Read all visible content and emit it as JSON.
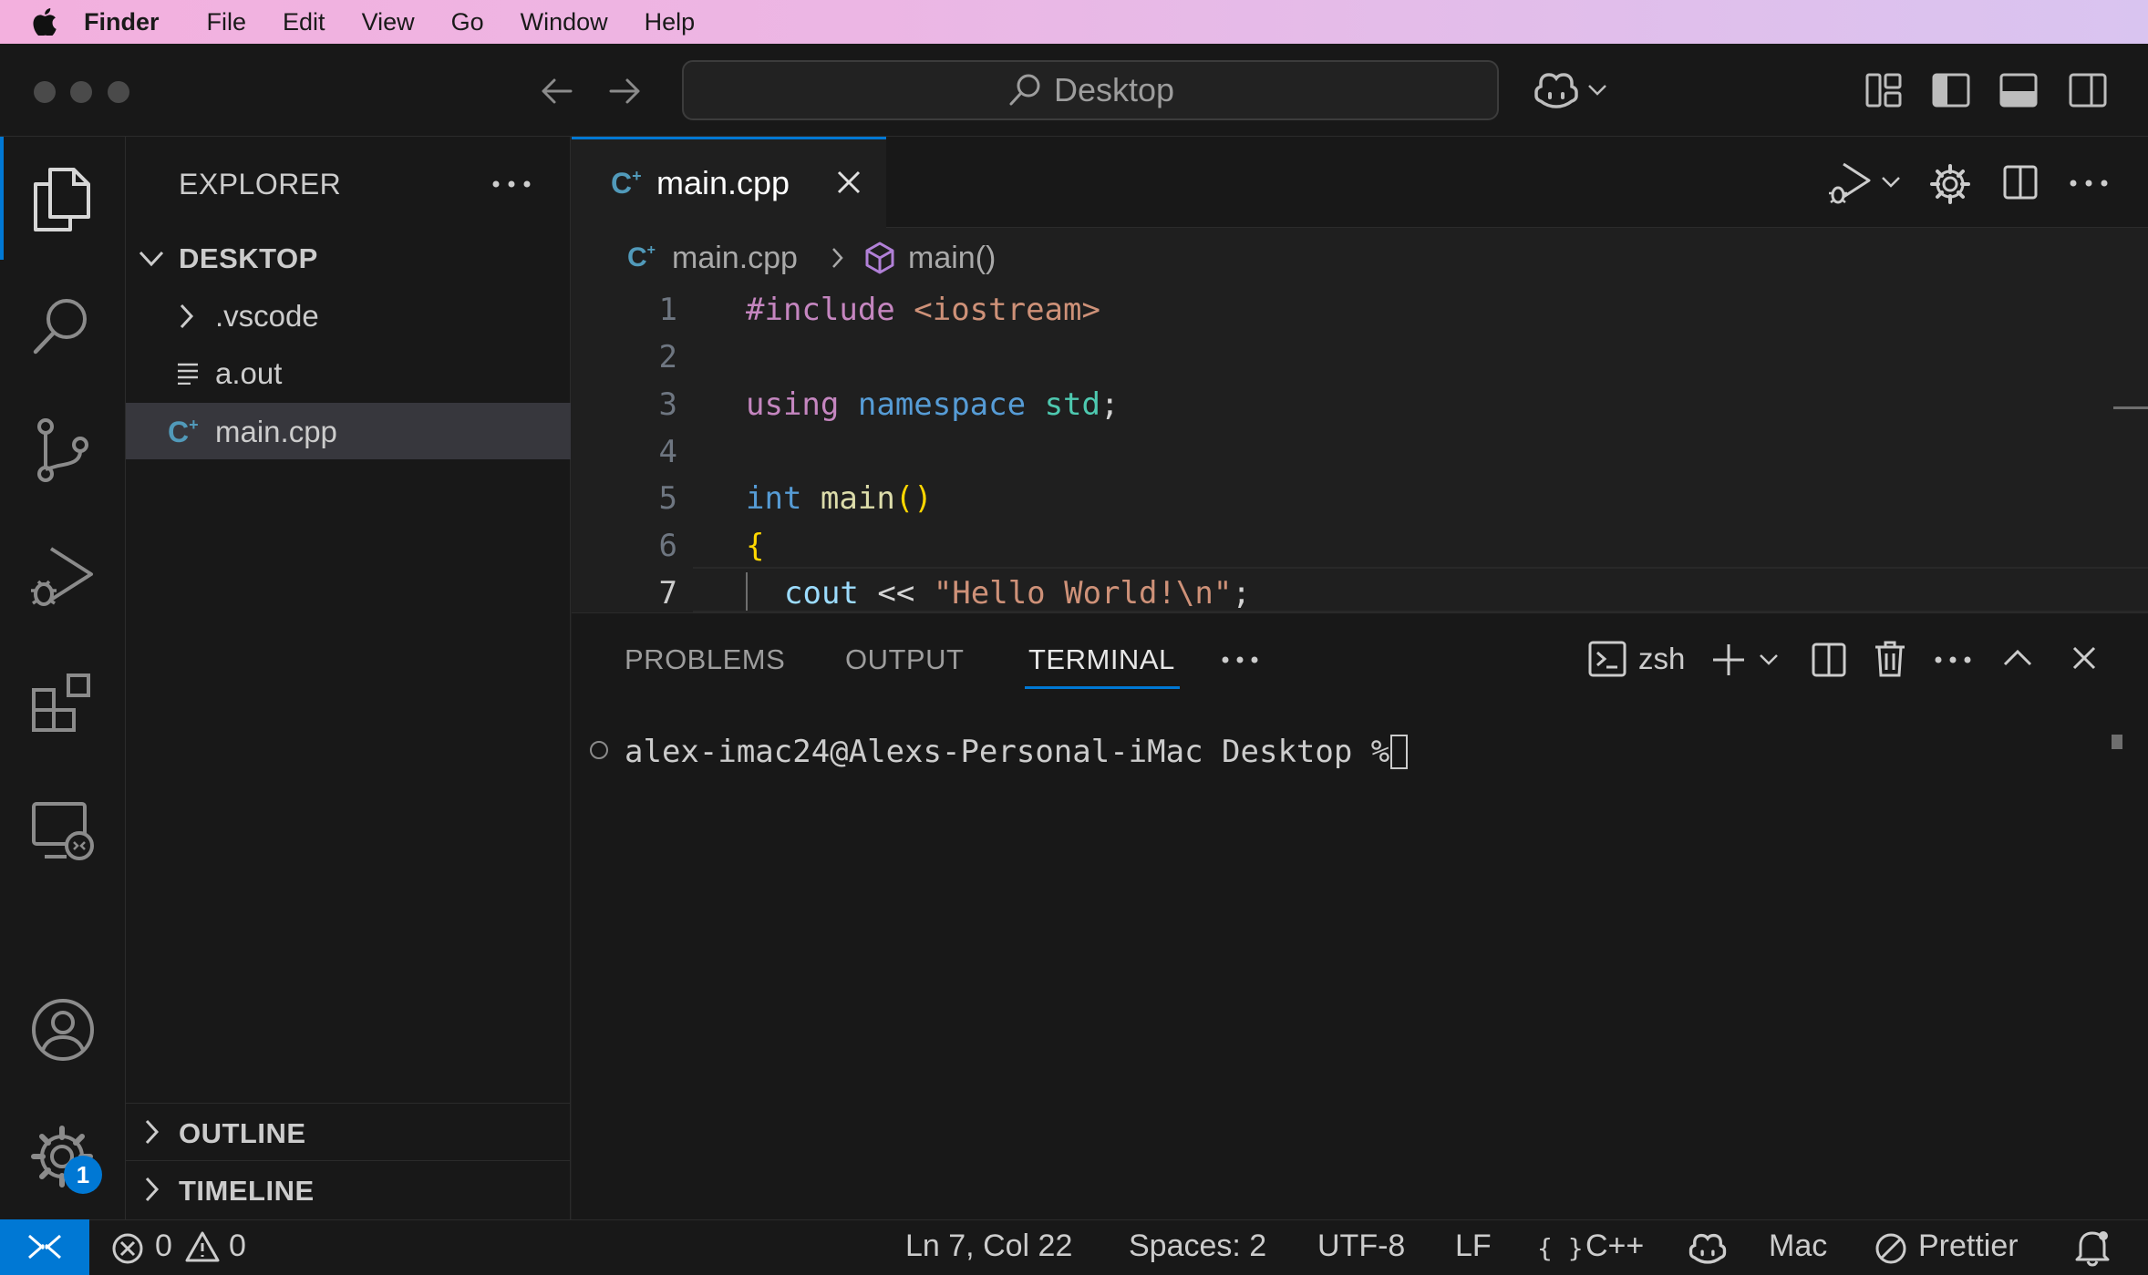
{
  "menubar": {
    "app": "Finder",
    "items": [
      "File",
      "Edit",
      "View",
      "Go",
      "Window",
      "Help"
    ]
  },
  "titlebar": {
    "search": "Desktop"
  },
  "explorer": {
    "title": "EXPLORER",
    "root": "DESKTOP",
    "items": [
      {
        "label": ".vscode",
        "kind": "folder"
      },
      {
        "label": "a.out",
        "kind": "file"
      },
      {
        "label": "main.cpp",
        "kind": "cpp",
        "selected": true
      }
    ],
    "outline": "OUTLINE",
    "timeline": "TIMELINE"
  },
  "editor": {
    "tab": "main.cpp",
    "breadcrumb": {
      "file": "main.cpp",
      "symbol": "main()"
    },
    "line_numbers": [
      "1",
      "2",
      "3",
      "4",
      "5",
      "6",
      "7"
    ],
    "lines": {
      "l1_a": "#include",
      "l1_b": "<iostream>",
      "l3_a": "using",
      "l3_b": "namespace",
      "l3_c": "std",
      "l3_d": ";",
      "l5_a": "int",
      "l5_b": "main",
      "l5_c": "()",
      "l6_a": "{",
      "l7_a": "cout",
      "l7_b": "<<",
      "l7_c": "\"Hello World!\\n\"",
      "l7_d": ";"
    }
  },
  "panel": {
    "tabs": [
      "PROBLEMS",
      "OUTPUT",
      "TERMINAL"
    ],
    "active_tab": "TERMINAL",
    "shell": "zsh",
    "prompt": "alex-imac24@Alexs-Personal-iMac Desktop % "
  },
  "statusbar": {
    "errors": "0",
    "warnings": "0",
    "position": "Ln 7, Col 22",
    "spaces": "Spaces: 2",
    "encoding": "UTF-8",
    "eol": "LF",
    "language_icon": "{ }",
    "language": "C++",
    "mac": "Mac",
    "prettier": "Prettier"
  },
  "badges": {
    "settings": "1"
  },
  "colors": {
    "accent": "#0078d4",
    "background": "#1f1f1f",
    "sidebar": "#181818"
  }
}
